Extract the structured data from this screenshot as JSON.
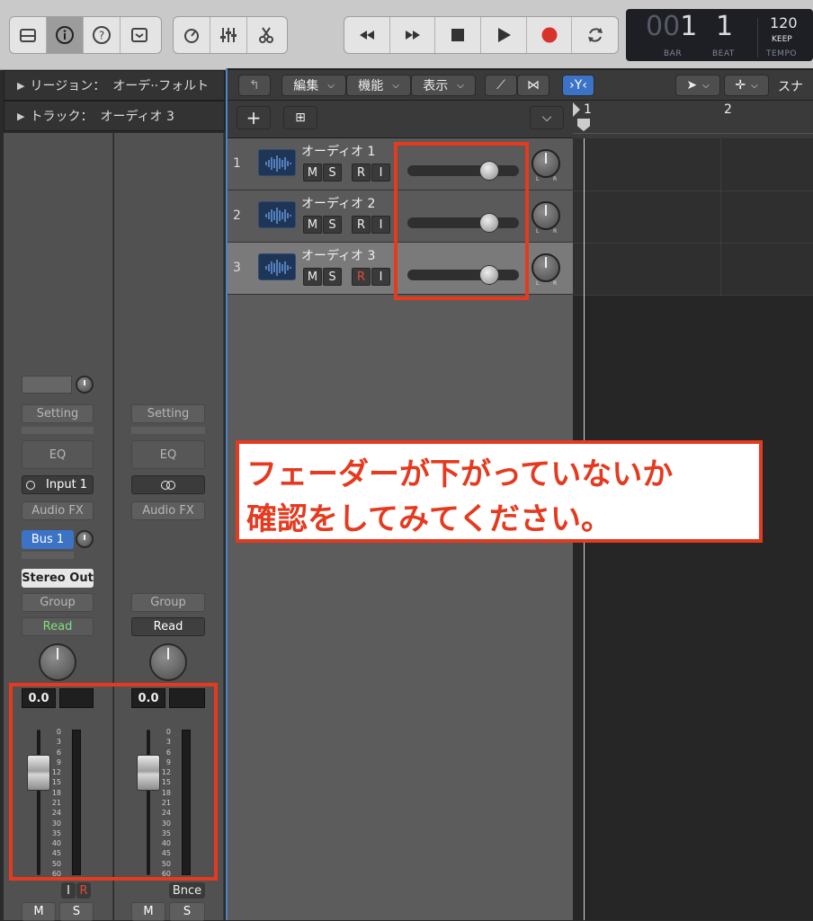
{
  "toolbar": {
    "left_buttons": [
      "library-icon",
      "inspector-icon",
      "help-icon",
      "toolbar-icon"
    ],
    "edit_buttons": [
      "tuner-icon",
      "mixer-icon",
      "scissors-icon"
    ],
    "transport_buttons": [
      "rewind-icon",
      "fast-forward-icon",
      "stop-icon",
      "play-icon",
      "record-icon",
      "cycle-icon"
    ]
  },
  "lcd": {
    "bar_dim": "00",
    "bar": "1",
    "beat": "1",
    "bar_label": "BAR",
    "beat_label": "BEAT",
    "tempo": "120",
    "tempo_mode": "KEEP",
    "tempo_label": "TEMPO"
  },
  "inspector": {
    "region_label": "リージョン：",
    "region_value": "オーデ··フォルト",
    "track_label": "トラック：",
    "track_value": "オーディオ 3"
  },
  "strip1": {
    "setting": "Setting",
    "eq": "EQ",
    "input": "Input 1",
    "audio_fx": "Audio FX",
    "send": "Bus 1",
    "output": "Stereo Out",
    "group": "Group",
    "automation": "Read",
    "volume": "0.0",
    "input_btn": "I",
    "record_btn": "R",
    "mute": "M",
    "solo": "S"
  },
  "strip2": {
    "setting": "Setting",
    "eq": "EQ",
    "audio_fx": "Audio FX",
    "group": "Group",
    "automation": "Read",
    "volume": "0.0",
    "bounce": "Bnce",
    "mute": "M",
    "solo": "S"
  },
  "meter_scale": [
    "0",
    "3",
    "6",
    "9",
    "12",
    "15",
    "18",
    "21",
    "24",
    "30",
    "35",
    "40",
    "45",
    "50",
    "60"
  ],
  "tracks_toolbar": {
    "edit": "編集",
    "functions": "機能",
    "view": "表示",
    "snap": "スナッ"
  },
  "ruler": {
    "bar1": "1",
    "bar2": "2"
  },
  "tracks": [
    {
      "num": "1",
      "name": "オーディオ 1",
      "m": "M",
      "s": "S",
      "r": "R",
      "i": "I",
      "fader": 0.73,
      "armed": false
    },
    {
      "num": "2",
      "name": "オーディオ 2",
      "m": "M",
      "s": "S",
      "r": "R",
      "i": "I",
      "fader": 0.73,
      "armed": false
    },
    {
      "num": "3",
      "name": "オーディオ 3",
      "m": "M",
      "s": "S",
      "r": "R",
      "i": "I",
      "fader": 0.73,
      "armed": true
    }
  ],
  "pan_labels": {
    "l": "L",
    "r": "R"
  },
  "callout": {
    "line1": "フェーダーが下がっていないか",
    "line2": "確認をしてみてください。"
  },
  "colors": {
    "annotation": "#e53a1f",
    "selection_blue": "#3c73c7",
    "record_red": "#d8322a"
  }
}
